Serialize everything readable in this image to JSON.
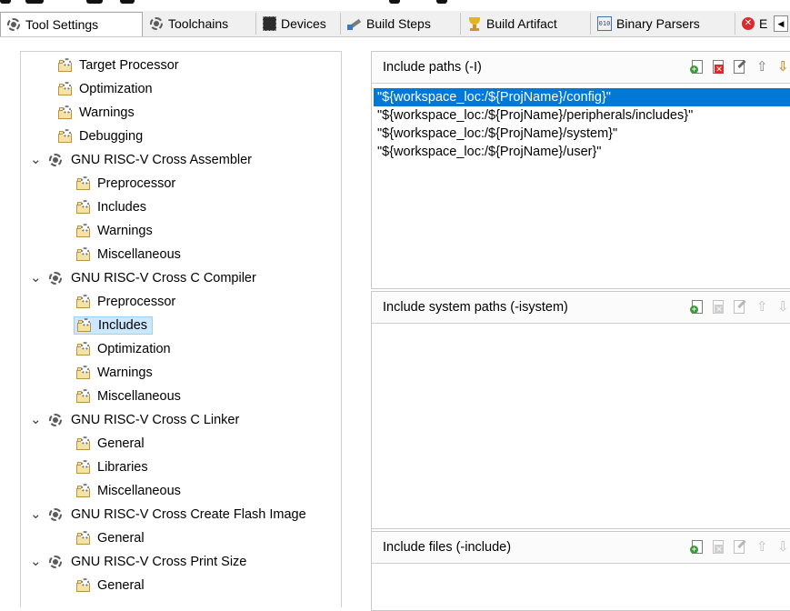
{
  "tabs": [
    {
      "label": "Tool Settings",
      "icon": "gear-icon",
      "active": true
    },
    {
      "label": "Toolchains",
      "icon": "gear-icon"
    },
    {
      "label": "Devices",
      "icon": "chip-icon"
    },
    {
      "label": "Build Steps",
      "icon": "build-steps-icon"
    },
    {
      "label": "Build Artifact",
      "icon": "trophy-icon"
    },
    {
      "label": "Binary Parsers",
      "icon": "binary-icon"
    },
    {
      "label": "E",
      "icon": "error-icon"
    }
  ],
  "tree": {
    "items": [
      {
        "label": "Target Processor",
        "level": 1,
        "icon": "settings-folder-icon"
      },
      {
        "label": "Optimization",
        "level": 1,
        "icon": "settings-folder-icon"
      },
      {
        "label": "Warnings",
        "level": 1,
        "icon": "settings-folder-icon"
      },
      {
        "label": "Debugging",
        "level": 1,
        "icon": "settings-folder-icon"
      },
      {
        "label": "GNU RISC-V Cross Assembler",
        "level": 0,
        "icon": "tool-gear-icon",
        "expanded": true
      },
      {
        "label": "Preprocessor",
        "level": 2,
        "icon": "settings-folder-icon"
      },
      {
        "label": "Includes",
        "level": 2,
        "icon": "settings-folder-icon"
      },
      {
        "label": "Warnings",
        "level": 2,
        "icon": "settings-folder-icon"
      },
      {
        "label": "Miscellaneous",
        "level": 2,
        "icon": "settings-folder-icon"
      },
      {
        "label": "GNU RISC-V Cross C Compiler",
        "level": 0,
        "icon": "tool-gear-icon",
        "expanded": true
      },
      {
        "label": "Preprocessor",
        "level": 2,
        "icon": "settings-folder-icon"
      },
      {
        "label": "Includes",
        "level": 2,
        "icon": "settings-folder-icon",
        "selected": true
      },
      {
        "label": "Optimization",
        "level": 2,
        "icon": "settings-folder-icon"
      },
      {
        "label": "Warnings",
        "level": 2,
        "icon": "settings-folder-icon"
      },
      {
        "label": "Miscellaneous",
        "level": 2,
        "icon": "settings-folder-icon"
      },
      {
        "label": "GNU RISC-V Cross C Linker",
        "level": 0,
        "icon": "tool-gear-icon",
        "expanded": true
      },
      {
        "label": "General",
        "level": 2,
        "icon": "settings-folder-icon"
      },
      {
        "label": "Libraries",
        "level": 2,
        "icon": "settings-folder-icon"
      },
      {
        "label": "Miscellaneous",
        "level": 2,
        "icon": "settings-folder-icon"
      },
      {
        "label": "GNU RISC-V Cross Create Flash Image",
        "level": 0,
        "icon": "tool-gear-icon",
        "expanded": true
      },
      {
        "label": "General",
        "level": 2,
        "icon": "settings-folder-icon"
      },
      {
        "label": "GNU RISC-V Cross Print Size",
        "level": 0,
        "icon": "tool-gear-icon",
        "expanded": true
      },
      {
        "label": "General",
        "level": 2,
        "icon": "settings-folder-icon"
      }
    ]
  },
  "sections": {
    "include_paths": {
      "title": "Include paths (-I)",
      "items": [
        {
          "text": "\"${workspace_loc:/${ProjName}/config}\"",
          "selected": true
        },
        {
          "text": "\"${workspace_loc:/${ProjName}/peripherals/includes}\""
        },
        {
          "text": "\"${workspace_loc:/${ProjName}/system}\""
        },
        {
          "text": "\"${workspace_loc:/${ProjName}/user}\""
        }
      ]
    },
    "include_system_paths": {
      "title": "Include system paths (-isystem)",
      "items": []
    },
    "include_files": {
      "title": "Include files (-include)",
      "items": []
    }
  },
  "colors": {
    "selection_blue": "#0078d7",
    "tree_selection": "#cce8ff"
  }
}
